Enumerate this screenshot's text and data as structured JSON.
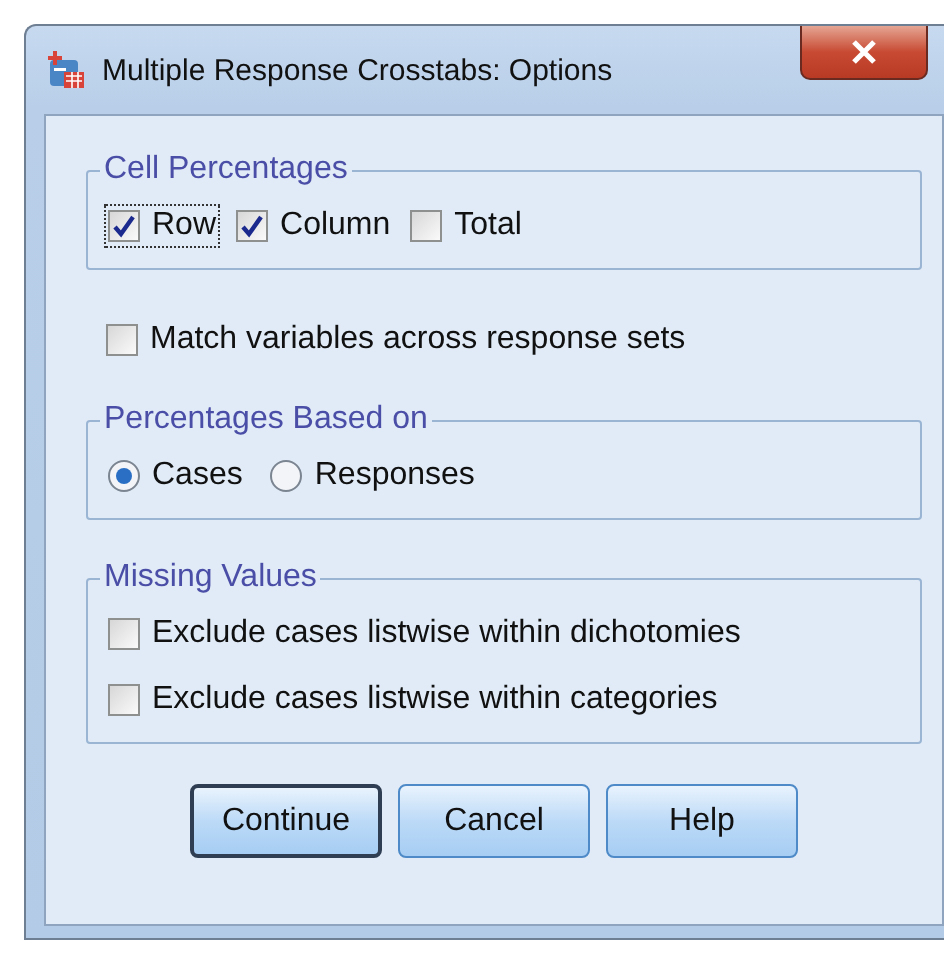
{
  "window": {
    "title": "Multiple Response Crosstabs: Options"
  },
  "cell_percentages": {
    "title": "Cell Percentages",
    "options": [
      {
        "label": "Row",
        "checked": true,
        "focused": true
      },
      {
        "label": "Column",
        "checked": true,
        "focused": false
      },
      {
        "label": "Total",
        "checked": false,
        "focused": false
      }
    ]
  },
  "match_variables": {
    "label": "Match variables across response sets",
    "checked": false
  },
  "percentages_based_on": {
    "title": "Percentages Based on",
    "options": [
      {
        "label": "Cases",
        "selected": true
      },
      {
        "label": "Responses",
        "selected": false
      }
    ]
  },
  "missing_values": {
    "title": "Missing Values",
    "options": [
      {
        "label": "Exclude cases listwise within dichotomies",
        "checked": false
      },
      {
        "label": "Exclude cases listwise within categories",
        "checked": false
      }
    ]
  },
  "buttons": [
    {
      "label": "Continue",
      "default": true
    },
    {
      "label": "Cancel",
      "default": false
    },
    {
      "label": "Help",
      "default": false
    }
  ]
}
